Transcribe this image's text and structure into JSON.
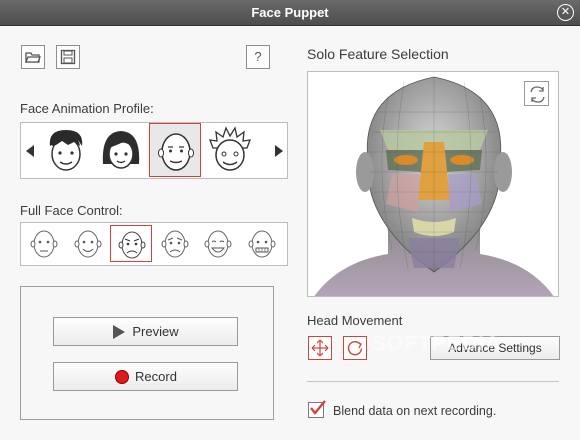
{
  "window": {
    "title": "Face Puppet",
    "close_glyph": "⊗"
  },
  "toolbar": {
    "help_label": "?"
  },
  "profile": {
    "label": "Face Animation Profile:",
    "items": [
      "boy",
      "girl",
      "bald",
      "spiky"
    ],
    "selected_index": 2
  },
  "full_face": {
    "label": "Full Face Control:",
    "items": [
      "face-1",
      "face-2",
      "face-3",
      "face-4",
      "face-5",
      "face-6"
    ],
    "selected_index": 2
  },
  "actions": {
    "preview_label": "Preview",
    "record_label": "Record"
  },
  "solo": {
    "label": "Solo Feature Selection"
  },
  "head": {
    "label": "Head Movement",
    "advance_label": "Advance Settings"
  },
  "blend": {
    "label": "Blend data on next recording.",
    "checked": true
  },
  "watermark": "SOFTPEDIA",
  "colors": {
    "accent": "#d0443a",
    "title_bg": "#545454",
    "record_dot": "#e01a1a"
  }
}
